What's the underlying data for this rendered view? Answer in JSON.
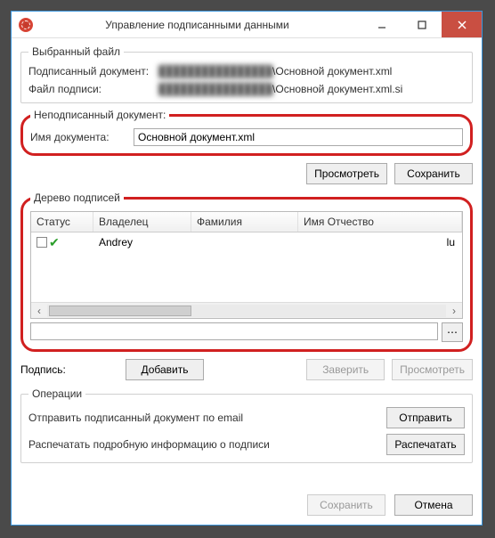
{
  "window": {
    "title": "Управление подписанными данными"
  },
  "selected_file": {
    "legend": "Выбранный файл",
    "signed_doc_label": "Подписанный документ:",
    "signed_doc_blur": "████████████████",
    "signed_doc_value": "\\Основной документ.xml",
    "sig_file_label": "Файл подписи:",
    "sig_file_blur": "████████████████",
    "sig_file_value": "\\Основной документ.xml.si"
  },
  "unsigned": {
    "legend": "Неподписанный документ:",
    "name_label": "Имя документа:",
    "name_value": "Основной документ.xml"
  },
  "buttons": {
    "view": "Просмотреть",
    "save": "Сохранить",
    "add": "Добавить",
    "certify": "Заверить",
    "send": "Отправить",
    "print": "Распечатать",
    "cancel": "Отмена"
  },
  "tree": {
    "legend": "Дерево подписей",
    "col_status": "Статус",
    "col_owner": "Владелец",
    "col_surname": "Фамилия",
    "col_name_patronym": "Имя Отчество",
    "row0": {
      "owner": "Andrey",
      "tail": "lu"
    }
  },
  "signature": {
    "label": "Подпись:"
  },
  "ops": {
    "legend": "Операции",
    "send_label": "Отправить подписанный документ по email",
    "print_label": "Распечатать подробную информацию о подписи"
  }
}
